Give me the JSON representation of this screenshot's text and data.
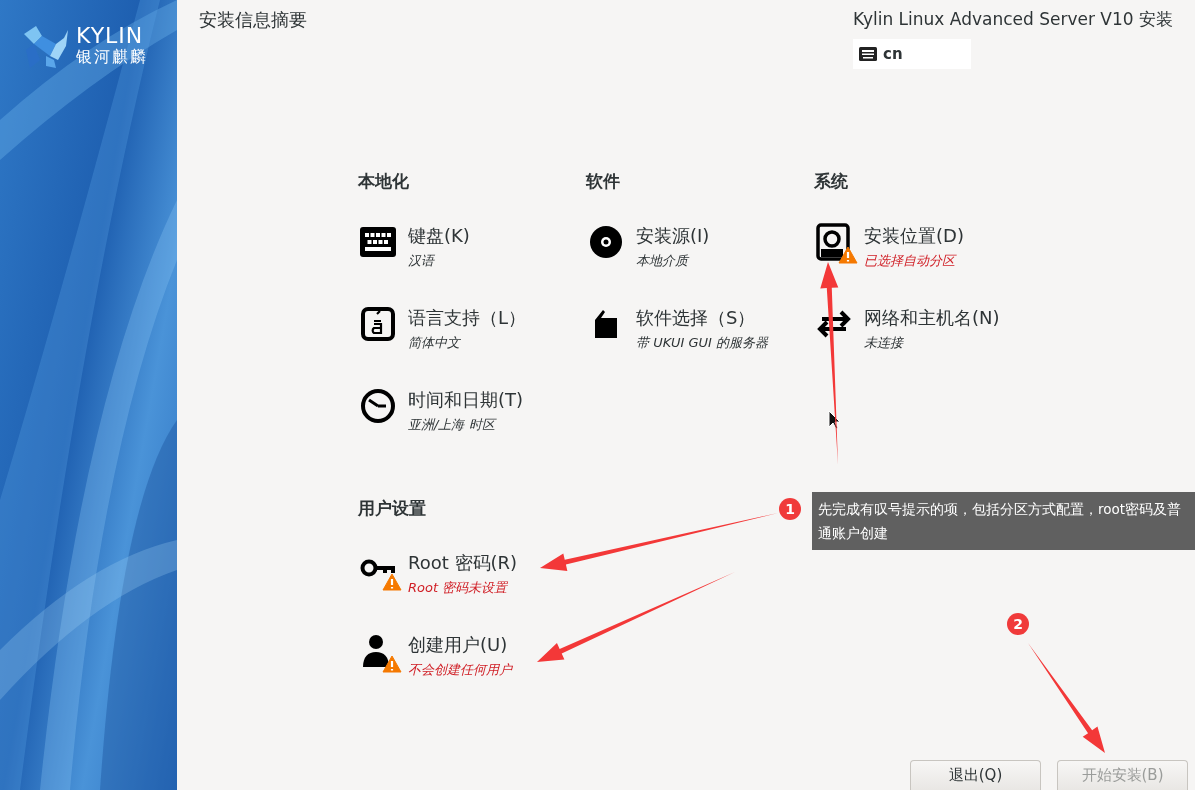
{
  "logo": {
    "wordmark": "KYLIN",
    "subtitle": "银河麒麟"
  },
  "header": {
    "title": "安装信息摘要",
    "product": "Kylin Linux Advanced Server V10 安装",
    "keyboard_layout": "cn"
  },
  "sections": [
    {
      "heading": "本地化",
      "items": [
        {
          "kind": "keyboard",
          "title": "键盘(K)",
          "status": "汉语",
          "warning": false
        },
        {
          "kind": "language",
          "title": "语言支持（L）",
          "status": "简体中文",
          "warning": false
        },
        {
          "kind": "clock",
          "title": "时间和日期(T)",
          "status": "亚洲/上海 时区",
          "warning": false
        }
      ]
    },
    {
      "heading": "软件",
      "items": [
        {
          "kind": "disc",
          "title": "安装源(I)",
          "status": "本地介质",
          "warning": false
        },
        {
          "kind": "package",
          "title": "软件选择（S）",
          "status": "带 UKUI GUI 的服务器",
          "warning": false
        }
      ]
    },
    {
      "heading": "系统",
      "items": [
        {
          "kind": "disk",
          "title": "安装位置(D)",
          "status": "已选择自动分区",
          "warning": true
        },
        {
          "kind": "network",
          "title": "网络和主机名(N)",
          "status": "未连接",
          "warning": false
        }
      ]
    },
    {
      "heading": "用户设置",
      "items": [
        {
          "kind": "key",
          "title": "Root 密码(R)",
          "status": "Root 密码未设置",
          "warning": true
        },
        {
          "kind": "user",
          "title": "创建用户(U)",
          "status": "不会创建任何用户",
          "warning": true
        }
      ]
    }
  ],
  "buttons": [
    {
      "label": "退出(Q)",
      "disabled": false
    },
    {
      "label": "开始安装(B)",
      "disabled": true
    }
  ],
  "annotations": {
    "badges": [
      "1",
      "2"
    ],
    "note": "先完成有叹号提示的项，包括分区方式配置，root密码及普通账户创建"
  }
}
